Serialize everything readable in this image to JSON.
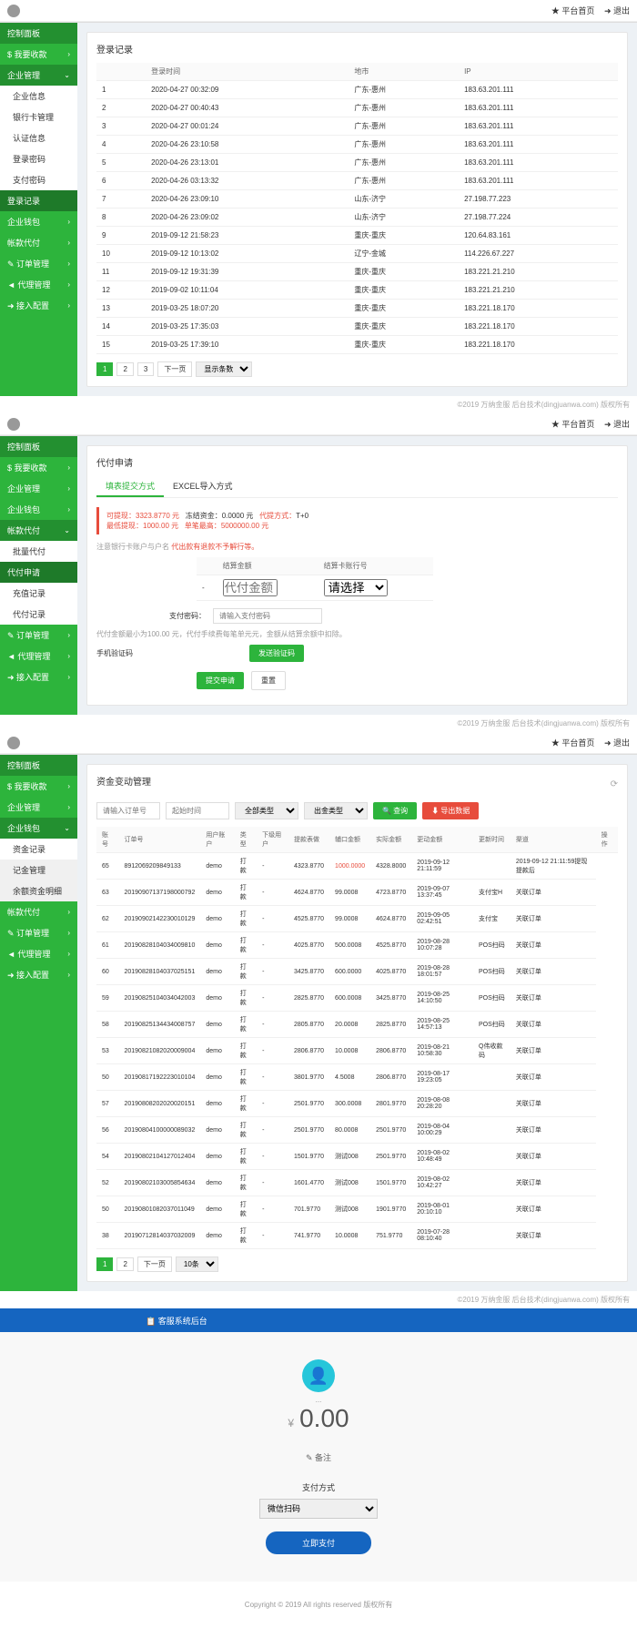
{
  "topbar": {
    "link1": "★ 平台首页",
    "link2": "➜ 退出"
  },
  "sidebar1": {
    "items": [
      "控制面板",
      "$ 我要收款",
      "企业管理"
    ],
    "subs": [
      "企业信息",
      "银行卡管理",
      "认证信息",
      "登录密码",
      "支付密码",
      "登录记录"
    ],
    "items2": [
      "企业钱包",
      "帐款代付",
      "✎ 订单管理",
      "◄ 代理管理",
      "➜ 接入配置"
    ]
  },
  "panel1": {
    "title": "登录记录",
    "headers": [
      "",
      "登录时间",
      "地市",
      "IP"
    ],
    "rows": [
      [
        "1",
        "2020-04-27 00:32:09",
        "广东-惠州",
        "183.63.201.111"
      ],
      [
        "2",
        "2020-04-27 00:40:43",
        "广东-惠州",
        "183.63.201.111"
      ],
      [
        "3",
        "2020-04-27 00:01:24",
        "广东-惠州",
        "183.63.201.111"
      ],
      [
        "4",
        "2020-04-26 23:10:58",
        "广东-惠州",
        "183.63.201.111"
      ],
      [
        "5",
        "2020-04-26 23:13:01",
        "广东-惠州",
        "183.63.201.111"
      ],
      [
        "6",
        "2020-04-26 03:13:32",
        "广东-惠州",
        "183.63.201.111"
      ],
      [
        "7",
        "2020-04-26 23:09:10",
        "山东-济宁",
        "27.198.77.223"
      ],
      [
        "8",
        "2020-04-26 23:09:02",
        "山东-济宁",
        "27.198.77.224"
      ],
      [
        "9",
        "2019-09-12 21:58:23",
        "重庆-重庆",
        "120.64.83.161"
      ],
      [
        "10",
        "2019-09-12 10:13:02",
        "辽宁-金城",
        "114.226.67.227"
      ],
      [
        "11",
        "2019-09-12 19:31:39",
        "重庆-重庆",
        "183.221.21.210"
      ],
      [
        "12",
        "2019-09-02 10:11:04",
        "重庆-重庆",
        "183.221.21.210"
      ],
      [
        "13",
        "2019-03-25 18:07:20",
        "重庆-重庆",
        "183.221.18.170"
      ],
      [
        "14",
        "2019-03-25 17:35:03",
        "重庆-重庆",
        "183.221.18.170"
      ],
      [
        "15",
        "2019-03-25 17:39:10",
        "重庆-重庆",
        "183.221.18.170"
      ]
    ],
    "pages": [
      "1",
      "2",
      "3",
      "下一页"
    ],
    "pagesize": "显示条数"
  },
  "footer_note": "©2019 万纳金服 后台技术(dingjuanwa.com) 版权所有",
  "sidebar2": {
    "items": [
      "控制面板",
      "$ 我要收款",
      "企业管理",
      "企业钱包",
      "帐款代付"
    ],
    "subs": [
      "批量代付",
      "代付申请",
      "充值记录",
      "代付记录"
    ],
    "items2": [
      "✎ 订单管理",
      "◄ 代理管理",
      "➜ 接入配置"
    ]
  },
  "panel2": {
    "title": "代付申请",
    "tab1": "填表提交方式",
    "tab2": "EXCEL导入方式",
    "balance_label": "可提现：",
    "balance": "3323.8770 元",
    "frozen_label": "冻结资金：",
    "frozen": "0.0000 元",
    "mode_label": "代提方式：",
    "mode": "T+0",
    "min_label": "最低提现：",
    "min": "1000.00 元",
    "max_label": "单笔最高：",
    "max": "5000000.00 元",
    "warn_prefix": "注意银行卡账户与户名",
    "warn": "代出款有退款不予解行等。",
    "th_amount": "结算金额",
    "th_bank": "结算卡账行号",
    "amount_ph": "代付金额",
    "bank_ph": "请选择",
    "pwd_label": "支付密码：",
    "pwd_ph": "请输入支付密码",
    "note1": "代付金额最小为100.00 元，代付手续费每笔单元元，金额从结算余额中扣除。",
    "note2": "手机验证码",
    "btn_code": "发送验证码",
    "btn_submit": "提交申请",
    "btn_reset": "重置"
  },
  "sidebar3": {
    "items": [
      "控制面板",
      "$ 我要收款",
      "企业管理",
      "企业钱包"
    ],
    "subs": [
      "资金记录",
      "记金管理",
      "余额资金明细"
    ],
    "items2": [
      "帐款代付",
      "✎ 订单管理",
      "◄ 代理管理",
      "➜ 接入配置"
    ]
  },
  "panel3": {
    "title": "资金变动管理",
    "filter_order_ph": "请输入订单号",
    "filter_time_ph": "起始时间",
    "filter_all": "全部类型",
    "filter_type": "出金类型",
    "btn_search": "🔍 查询",
    "btn_export": "⬇ 导出数据",
    "headers": [
      "账号",
      "订单号",
      "用户账户",
      "类型",
      "下级用户",
      "提款表做",
      "辅口金额",
      "实际金额",
      "更动金额",
      "更新时间",
      "渠道",
      "操作"
    ],
    "rows": [
      [
        "65",
        "8912069209849133",
        "demo",
        "打款",
        "-",
        "4323.8770",
        "1000.0000",
        "4328.8000",
        "2019-09-12 21:11:59",
        "",
        "2019-09-12 21:11:59提现提款后"
      ],
      [
        "63",
        "20190907137198000792",
        "demo",
        "打款",
        "-",
        "4624.8770",
        "99.0008",
        "4723.8770",
        "2019-09-07 13:37:45",
        "支付宝H",
        "关联订单"
      ],
      [
        "62",
        "20190902142230010129",
        "demo",
        "打款",
        "-",
        "4525.8770",
        "99.0008",
        "4624.8770",
        "2019-09-05 02:42:51",
        "支付宝",
        "关联订单"
      ],
      [
        "61",
        "20190828104034009810",
        "demo",
        "打款",
        "-",
        "4025.8770",
        "500.0008",
        "4525.8770",
        "2019-08-28 10:07:28",
        "POS扫码",
        "关联订单"
      ],
      [
        "60",
        "20190828104037025151",
        "demo",
        "打款",
        "-",
        "3425.8770",
        "600.0000",
        "4025.8770",
        "2019-08-28 18:01:57",
        "POS扫码",
        "关联订单"
      ],
      [
        "59",
        "20190825104034042003",
        "demo",
        "打款",
        "-",
        "2825.8770",
        "600.0008",
        "3425.8770",
        "2019-08-25 14:10:50",
        "POS扫码",
        "关联订单"
      ],
      [
        "58",
        "20190825134434008757",
        "demo",
        "打款",
        "-",
        "2805.8770",
        "20.0008",
        "2825.8770",
        "2019-08-25 14:57:13",
        "POS扫码",
        "关联订单"
      ],
      [
        "53",
        "20190821082020009004",
        "demo",
        "打款",
        "-",
        "2806.8770",
        "10.0008",
        "2806.8770",
        "2019-08-21 10:58:30",
        "Q伟收款码",
        "关联订单"
      ],
      [
        "50",
        "20190817192223010104",
        "demo",
        "打款",
        "-",
        "3801.9770",
        "4.5008",
        "2806.8770",
        "2019-08-17 19:23:05",
        "",
        "关联订单"
      ],
      [
        "57",
        "20190808202020020151",
        "demo",
        "打款",
        "-",
        "2501.9770",
        "300.0008",
        "2801.9770",
        "2019-08-08 20:28:20",
        "",
        "关联订单"
      ],
      [
        "56",
        "20190804100000089032",
        "demo",
        "打款",
        "-",
        "2501.9770",
        "80.0008",
        "2501.9770",
        "2019-08-04 10:00:29",
        "",
        "关联订单"
      ],
      [
        "54",
        "20190802104127012404",
        "demo",
        "打款",
        "-",
        "1501.9770",
        "测试008",
        "2501.9770",
        "2019-08-02 10:48:49",
        "",
        "关联订单"
      ],
      [
        "52",
        "20190802103005854634",
        "demo",
        "打款",
        "-",
        "1601.4770",
        "测试008",
        "1501.9770",
        "2019-08-02 10:42:27",
        "",
        "关联订单"
      ],
      [
        "50",
        "20190801082037011049",
        "demo",
        "打款",
        "-",
        "701.9770",
        "测试008",
        "1901.9770",
        "2019-08-01 20:10:10",
        "",
        "关联订单"
      ],
      [
        "38",
        "20190712814037032009",
        "demo",
        "打款",
        "-",
        "741.9770",
        "10.0008",
        "751.9770",
        "2019-07-28 08:10:40",
        "",
        "关联订单"
      ]
    ],
    "pages": [
      "1",
      "2",
      "下一页"
    ],
    "pagesize": "10条"
  },
  "pay": {
    "header": "📋 客服系统后台",
    "amount": "0.00",
    "currency": "¥",
    "name": "...",
    "remark": "✎ 备注",
    "method_label": "支付方式",
    "method": "微信扫码",
    "btn": "立即支付",
    "copyright": "Copyright © 2019 All rights reserved 版权所有"
  }
}
